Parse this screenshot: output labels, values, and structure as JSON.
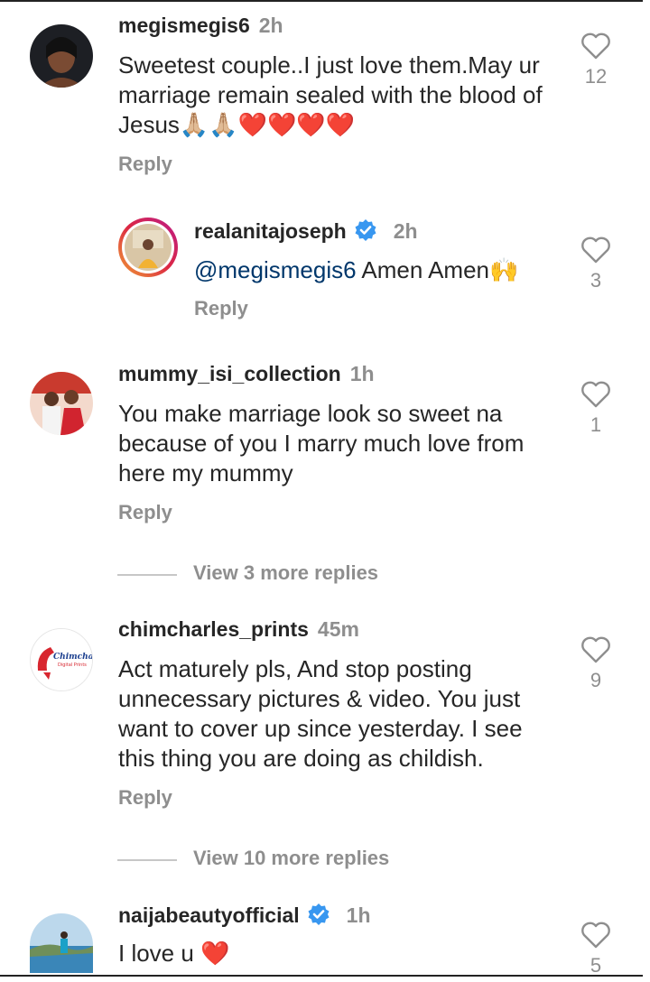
{
  "comments": [
    {
      "username": "megismegis6",
      "time": "2h",
      "text": "Sweetest couple..I just love them.May ur marriage remain sealed with the blood of Jesus",
      "emoji": "🙏🏼🙏🏼❤️❤️❤️❤️",
      "reply_label": "Reply",
      "likes": "12"
    },
    {
      "username": "realanitajoseph",
      "time": "2h",
      "mention": "@megismegis6",
      "text": "Amen Amen",
      "emoji": "🙌",
      "reply_label": "Reply",
      "likes": "3"
    },
    {
      "username": "mummy_isi_collection",
      "time": "1h",
      "text": "You make marriage look so sweet na because of you I marry much love from here my mummy",
      "reply_label": "Reply",
      "likes": "1",
      "view_more": "View 3 more replies"
    },
    {
      "username": "chimcharles_prints",
      "time": "45m",
      "avatar_text": "Chimcharles",
      "avatar_subtext": "Digital Prints",
      "text": "Act maturely pls, And stop posting unnecessary  pictures & video. You just want to cover up since yesterday.  I see this thing you are doing as  childish.",
      "reply_label": "Reply",
      "likes": "9",
      "view_more": "View 10 more replies"
    },
    {
      "username": "naijabeautyofficial",
      "time": "1h",
      "text": "I love u",
      "emoji": "❤️",
      "likes": "5"
    }
  ],
  "colors": {
    "primary_text": "#262626",
    "secondary_text": "#8e8e8e",
    "mention": "#00376b",
    "verified_badge": "#3897f0",
    "heart": "#e0245e"
  },
  "icons": [
    "heart-outline-icon",
    "verified-badge-icon"
  ]
}
